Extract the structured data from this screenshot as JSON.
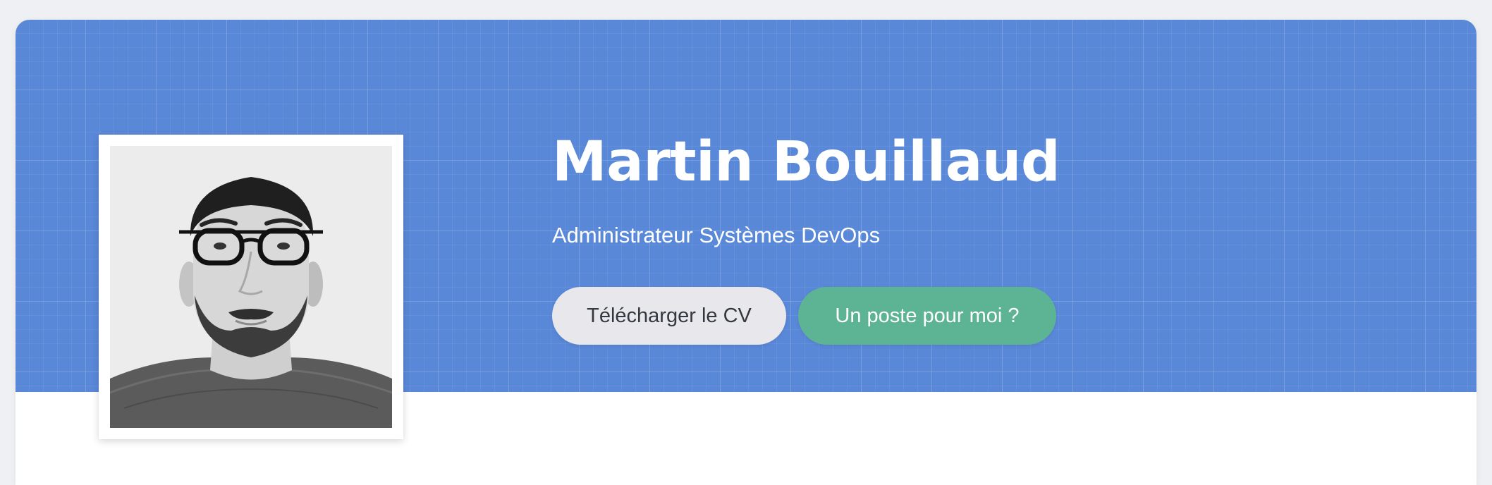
{
  "profile": {
    "name": "Martin Bouillaud",
    "title": "Administrateur Systèmes DevOps",
    "photo_alt": "Portrait de Martin Bouillaud"
  },
  "actions": {
    "download_cv_label": "Télécharger le CV",
    "hire_label": "Un poste pour moi ?"
  },
  "colors": {
    "hero_background": "#5a88d8",
    "cv_button": "#e8e8ec",
    "hire_button": "#5db495",
    "page_background": "#eff0f3"
  }
}
